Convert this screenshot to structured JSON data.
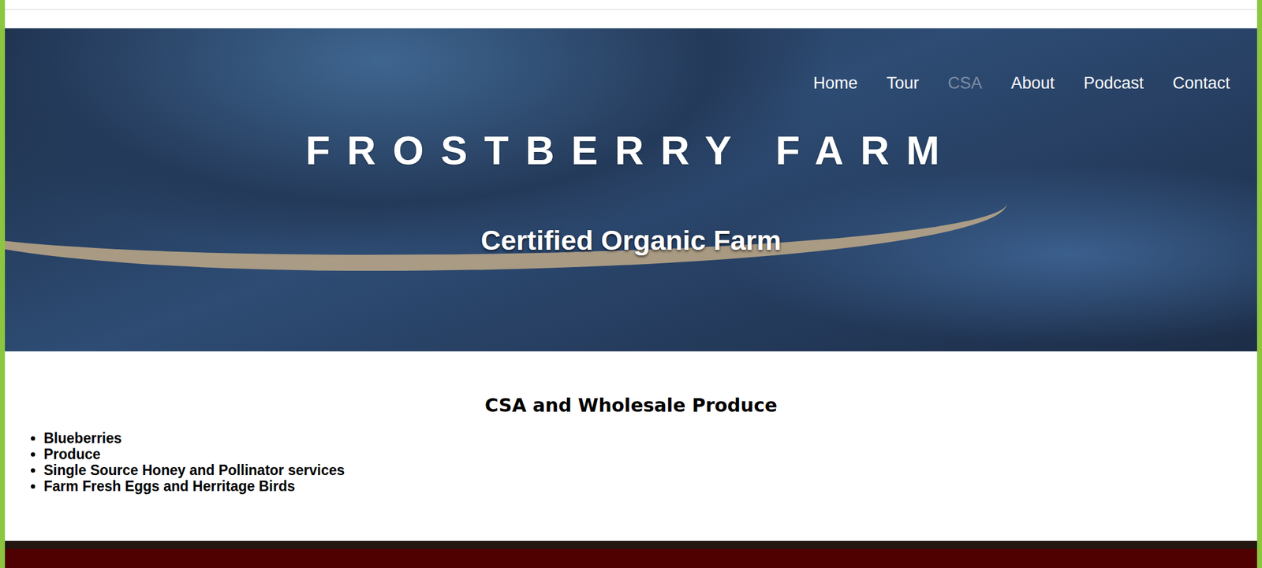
{
  "nav": [
    {
      "label": "Home",
      "selected": false
    },
    {
      "label": "Tour",
      "selected": false
    },
    {
      "label": "CSA",
      "selected": true
    },
    {
      "label": "About",
      "selected": false
    },
    {
      "label": "Podcast",
      "selected": false
    },
    {
      "label": "Contact",
      "selected": false
    }
  ],
  "hero": {
    "title": "FROSTBERRY FARM",
    "subtitle": "Certified Organic Farm"
  },
  "section": {
    "heading": "CSA and Wholesale Produce",
    "items": [
      "Blueberries",
      "Produce",
      "Single Source Honey and Pollinator services",
      "Farm Fresh Eggs and Herritage Birds"
    ]
  }
}
